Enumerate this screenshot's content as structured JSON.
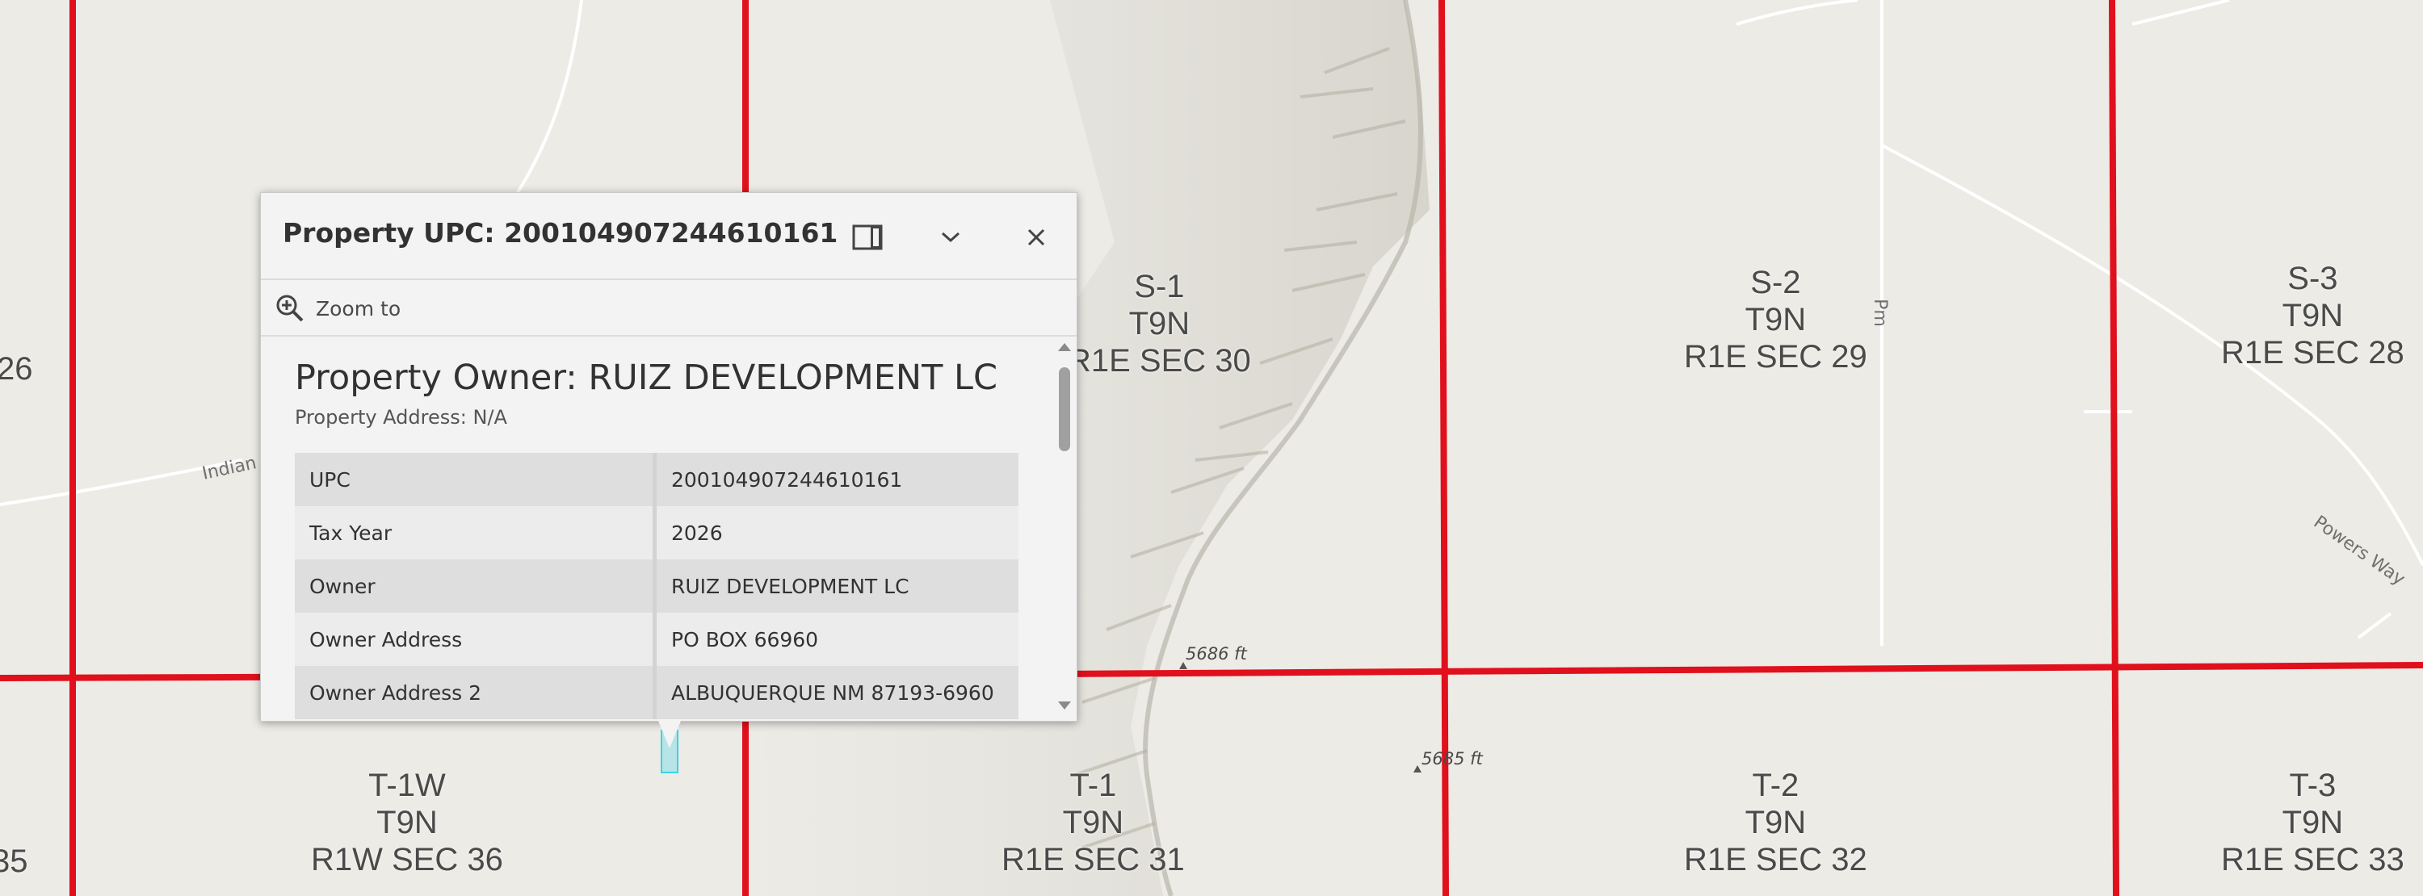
{
  "map": {
    "sections": [
      {
        "id": "s1",
        "lines": [
          "S-1",
          "T9N",
          "R1E SEC 30"
        ]
      },
      {
        "id": "s2",
        "lines": [
          "S-2",
          "T9N",
          "R1E SEC 29"
        ]
      },
      {
        "id": "s3",
        "lines": [
          "S-3",
          "T9N",
          "R1E SEC 28"
        ]
      },
      {
        "id": "t1w",
        "lines": [
          "T-1W",
          "T9N",
          "R1W SEC 36"
        ]
      },
      {
        "id": "t1",
        "lines": [
          "T-1",
          "T9N",
          "R1E SEC 31"
        ]
      },
      {
        "id": "t2",
        "lines": [
          "T-2",
          "T9N",
          "R1E SEC 32"
        ]
      },
      {
        "id": "t3",
        "lines": [
          "T-3",
          "T9N",
          "R1E SEC 33"
        ]
      },
      {
        "id": "left-top",
        "lines": [
          "26"
        ]
      },
      {
        "id": "left-bottom",
        "lines": [
          "35"
        ]
      }
    ],
    "roads": {
      "indian": "Indian",
      "pm": "Pm",
      "powers": "Powers Way"
    },
    "elevations": {
      "e1": "5686 ft",
      "e2": "5685 ft"
    },
    "colors": {
      "section_line": "#e0101c",
      "background": "#ecebe6",
      "selection": "#36d6e7"
    }
  },
  "popup": {
    "title": "Property UPC: 200104907244610161",
    "zoom_to": "Zoom to",
    "owner_heading": "Property Owner: RUIZ DEVELOPMENT LC",
    "address_line": "Property Address: N/A",
    "rows": [
      {
        "key": "UPC",
        "value": "200104907244610161"
      },
      {
        "key": "Tax Year",
        "value": "2026"
      },
      {
        "key": "Owner",
        "value": "RUIZ DEVELOPMENT LC"
      },
      {
        "key": "Owner Address",
        "value": "PO BOX 66960"
      },
      {
        "key": "Owner Address 2",
        "value": "ALBUQUERQUE NM 87193-6960"
      }
    ],
    "icons": {
      "dock": "dock-icon",
      "collapse": "chevron-down-icon",
      "close": "close-icon",
      "zoom": "zoom-in-icon"
    }
  }
}
